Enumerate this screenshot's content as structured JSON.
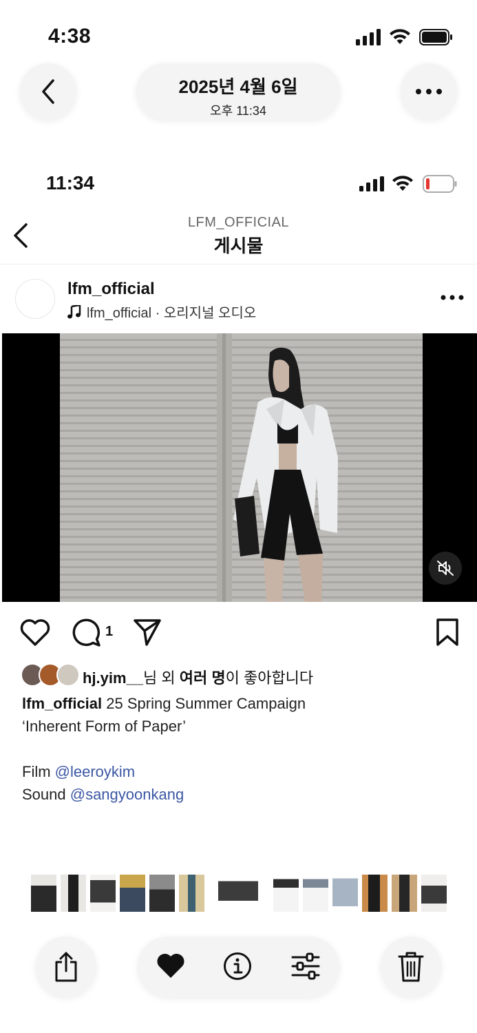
{
  "outer": {
    "time": "4:38",
    "date": "2025년 4월 6일",
    "date_sub": "오후 11:34"
  },
  "inner": {
    "time": "11:34",
    "battery_level": 0.1
  },
  "instagram": {
    "header_account": "LFM_OFFICIAL",
    "header_title": "게시물",
    "username": "lfm_official",
    "audio_label": "lfm_official · 오리지널 오디오",
    "comment_count": "1",
    "liked_by_user": "hj.yim__",
    "liked_by_suffix_1": "님 외 ",
    "liked_by_bold": "여러 명",
    "liked_by_suffix_2": "이 좋아합니다",
    "caption_user": "lfm_official",
    "caption_text": " 25 Spring Summer Campaign",
    "caption_line2": "‘Inherent Form of Paper’",
    "film_label": "Film ",
    "film_mention": "@leeroykim",
    "sound_label": "Sound ",
    "sound_mention": "@sangyoonkang"
  },
  "icons": {
    "back": "chevron-left-icon",
    "more": "ellipsis-icon",
    "music": "music-note-icon",
    "mute": "speaker-muted-icon",
    "like": "heart-outline-icon",
    "comment": "comment-bubble-icon",
    "share": "paper-plane-icon",
    "save": "bookmark-icon",
    "toolbar_share": "share-icon",
    "favorite": "heart-filled-icon",
    "info": "info-icon",
    "adjust": "sliders-icon",
    "trash": "trash-icon"
  },
  "colors": {
    "mention": "#3b57a5",
    "battery_low": "#e5352e"
  }
}
